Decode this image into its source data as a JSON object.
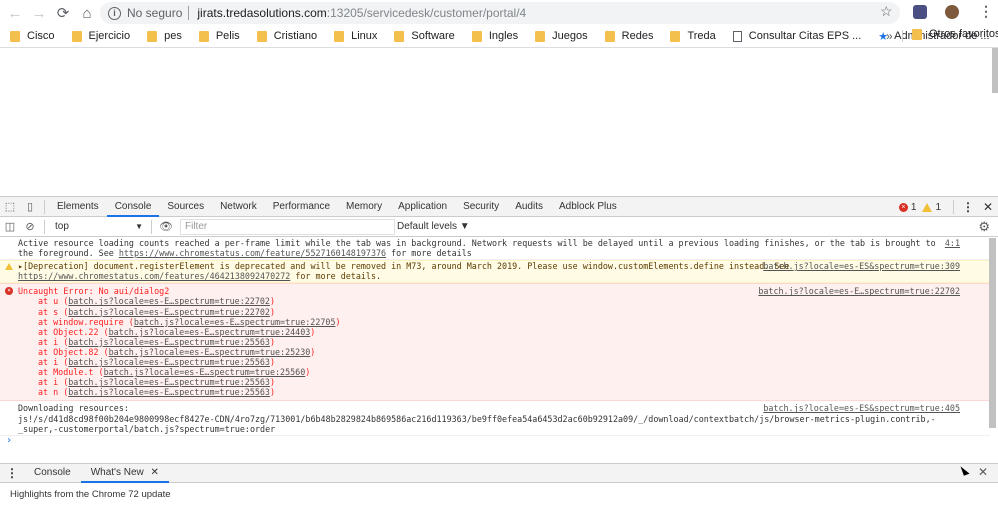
{
  "browser": {
    "security_label": "No seguro",
    "url_host": "jirats.tredasolutions.com",
    "url_path": ":13205/servicedesk/customer/portal/4"
  },
  "bookmarks": {
    "items": [
      {
        "label": "Cisco",
        "icon": "folder-icon"
      },
      {
        "label": "Ejercicio",
        "icon": "folder-icon"
      },
      {
        "label": "pes",
        "icon": "folder-icon"
      },
      {
        "label": "Pelis",
        "icon": "folder-icon"
      },
      {
        "label": "Cristiano",
        "icon": "folder-icon"
      },
      {
        "label": "Linux",
        "icon": "folder-icon"
      },
      {
        "label": "Software",
        "icon": "folder-icon"
      },
      {
        "label": "Ingles",
        "icon": "folder-icon"
      },
      {
        "label": "Juegos",
        "icon": "folder-icon"
      },
      {
        "label": "Redes",
        "icon": "folder-icon"
      },
      {
        "label": "Treda",
        "icon": "folder-icon"
      },
      {
        "label": "Consultar Citas EPS ...",
        "icon": "page-icon"
      },
      {
        "label": "Administrador de ...",
        "icon": "star-icon"
      }
    ],
    "overflow": "»",
    "other": "Otros favoritos"
  },
  "devtools": {
    "tabs": [
      "Elements",
      "Console",
      "Sources",
      "Network",
      "Performance",
      "Memory",
      "Application",
      "Security",
      "Audits",
      "Adblock Plus"
    ],
    "active_tab": "Console",
    "error_count": "1",
    "warning_count": "1",
    "context": "top",
    "filter_placeholder": "Filter",
    "levels": "Default levels ▼"
  },
  "console": {
    "msg1": {
      "text": "Active resource loading counts reached a per-frame limit while the tab was in background. Network requests will be delayed until a previous loading finishes, or the tab is brought to the foreground. See ",
      "link": "https://www.chromestatus.com/feature/5527160148197376",
      "suffix": " for more details",
      "source": "4:1"
    },
    "msg2": {
      "text": "▸[Deprecation] document.registerElement is deprecated and will be removed in M73, around March 2019. Please use window.customElements.define instead. See ",
      "link": "https://www.chromestatus.com/features/4642138092470272",
      "suffix": " for more details.",
      "source": "batch.js?locale=es-ES&spectrum=true:309"
    },
    "msg3": {
      "text": "Uncaught Error: No aui/dialog2",
      "source": "batch.js?locale=es-E…spectrum=true:22702",
      "stack": [
        {
          "fn": "at u (",
          "loc": "batch.js?locale=es-E…spectrum=true:22702",
          "end": ")"
        },
        {
          "fn": "at s (",
          "loc": "batch.js?locale=es-E…spectrum=true:22702",
          "end": ")"
        },
        {
          "fn": "at window.require (",
          "loc": "batch.js?locale=es-E…spectrum=true:22705",
          "end": ")"
        },
        {
          "fn": "at Object.22 (",
          "loc": "batch.js?locale=es-E…spectrum=true:24403",
          "end": ")"
        },
        {
          "fn": "at i (",
          "loc": "batch.js?locale=es-E…spectrum=true:25563",
          "end": ")"
        },
        {
          "fn": "at Object.82 (",
          "loc": "batch.js?locale=es-E…spectrum=true:25230",
          "end": ")"
        },
        {
          "fn": "at i (",
          "loc": "batch.js?locale=es-E…spectrum=true:25563",
          "end": ")"
        },
        {
          "fn": "at Module.t (",
          "loc": "batch.js?locale=es-E…spectrum=true:25560",
          "end": ")"
        },
        {
          "fn": "at i (",
          "loc": "batch.js?locale=es-E…spectrum=true:25563",
          "end": ")"
        },
        {
          "fn": "at n (",
          "loc": "batch.js?locale=es-E…spectrum=true:25563",
          "end": ")"
        }
      ]
    },
    "msg4": {
      "line1": "Downloading resources:",
      "line2": "js!/s/d41d8cd98f00b204e9800998ecf8427e-CDN/4ro7zg/713001/b6b48b2829824b869586ac216d119363/be9ff0efea54a6453d2ac60b92912a09/_/download/contextbatch/js/browser-metrics-plugin.contrib,-",
      "line3": "_super,-customerportal/batch.js?spectrum=true:order",
      "source": "batch.js?locale=es-ES&spectrum=true:405"
    },
    "prompt": "›"
  },
  "drawer": {
    "tabs": [
      "Console",
      "What's New"
    ],
    "active_tab": "What's New",
    "body": "Highlights from the Chrome 72 update"
  }
}
